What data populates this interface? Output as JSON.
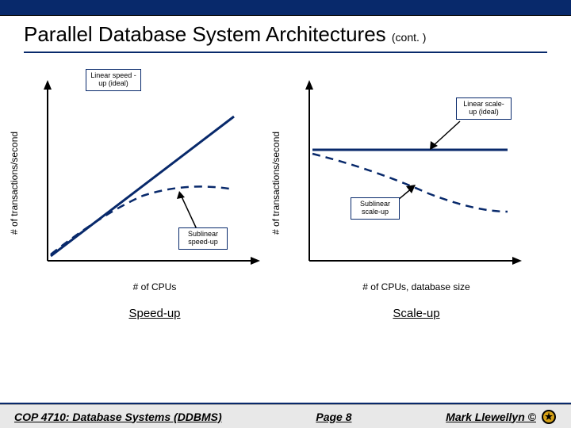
{
  "title_main": "Parallel Database System Architectures ",
  "title_cont": "(cont. )",
  "charts": {
    "left": {
      "y_label": "# of transactions/second",
      "x_label": "# of CPUs",
      "caption": "Speed-up",
      "label_ideal": "Linear speed\n-up (ideal)",
      "label_sub": "Sublinear\nspeed-up"
    },
    "right": {
      "y_label": "# of transactions/second",
      "x_label": "# of CPUs, database size",
      "caption": "Scale-up",
      "label_ideal": "Linear scale-\nup (ideal)",
      "label_sub": "Sublinear\nscale-up"
    }
  },
  "footer": {
    "left": "COP 4710: Database Systems  (DDBMS)",
    "center": "Page 8",
    "right": "Mark Llewellyn ©"
  },
  "chart_data": [
    {
      "type": "line",
      "title": "Speed-up",
      "xlabel": "# of CPUs",
      "ylabel": "# of transactions/second",
      "series": [
        {
          "name": "Linear speed-up (ideal)",
          "x": [
            0,
            10
          ],
          "y": [
            0,
            10
          ],
          "style": "solid"
        },
        {
          "name": "Sublinear speed-up",
          "x": [
            0,
            2,
            4,
            6,
            8,
            10
          ],
          "y": [
            0,
            2,
            3.3,
            4.0,
            4.2,
            4.1
          ],
          "style": "dashed"
        }
      ],
      "annotations": [
        "Linear speed-up (ideal)",
        "Sublinear speed-up"
      ]
    },
    {
      "type": "line",
      "title": "Scale-up",
      "xlabel": "# of CPUs, database size",
      "ylabel": "# of transactions/second",
      "series": [
        {
          "name": "Linear scale-up (ideal)",
          "x": [
            0,
            10
          ],
          "y": [
            5,
            5
          ],
          "style": "solid"
        },
        {
          "name": "Sublinear scale-up",
          "x": [
            0,
            2,
            4,
            6,
            8,
            10
          ],
          "y": [
            5,
            4.6,
            4.0,
            3.4,
            3.0,
            2.8
          ],
          "style": "dashed"
        }
      ],
      "annotations": [
        "Linear scale-up (ideal)",
        "Sublinear scale-up"
      ]
    }
  ]
}
